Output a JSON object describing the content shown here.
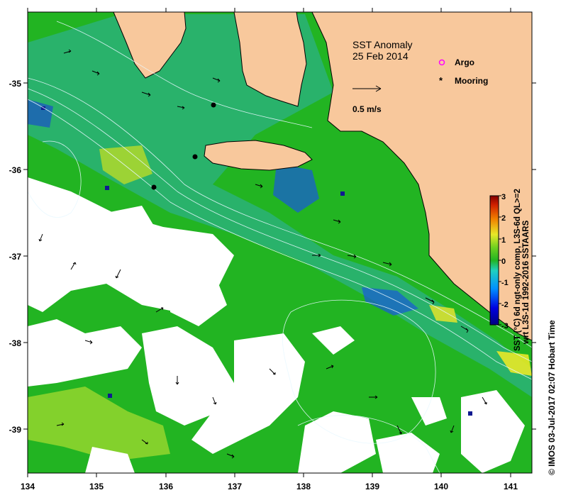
{
  "map": {
    "title": "SST Anomaly",
    "date": "25 Feb 2014",
    "scale_label": "0.5 m/s",
    "legend": [
      {
        "label": "Argo",
        "marker": "argo-icon",
        "color": "#ff00ff"
      },
      {
        "label": "Mooring",
        "marker": "mooring-icon",
        "color": "#000000"
      }
    ],
    "lon_ticks": [
      "134",
      "135",
      "136",
      "137",
      "138",
      "139",
      "140",
      "141"
    ],
    "lat_ticks": [
      "-35",
      "-36",
      "-37",
      "-38",
      "-39"
    ],
    "lon_range": [
      134,
      141.3
    ],
    "lat_range": [
      -39.45,
      -34.2
    ],
    "colorbar": {
      "ticks": [
        "3",
        "2",
        "1",
        "0",
        "-1",
        "-2",
        "-3"
      ],
      "range": [
        -3,
        3
      ],
      "label_line1": "SST (°C) 6d ngt-only comp, L3S-6d QL>=2",
      "label_line2": "wrt L3S-1d 1992-2016 SSTAARS"
    },
    "credit": "© IMOS 03-Jul-2017 02:07 Hobart Time",
    "colors": {
      "land": "#f8c89c",
      "no_data": "#ffffff",
      "anomaly_zero": "#22b422",
      "anomaly_cool": "#30b0e0",
      "anomaly_warm": "#e8e828"
    },
    "moorings": [
      {
        "lon": 136.7,
        "lat": -35.25
      },
      {
        "lon": 136.43,
        "lat": -35.85
      },
      {
        "lon": 135.85,
        "lat": -36.2
      }
    ]
  }
}
